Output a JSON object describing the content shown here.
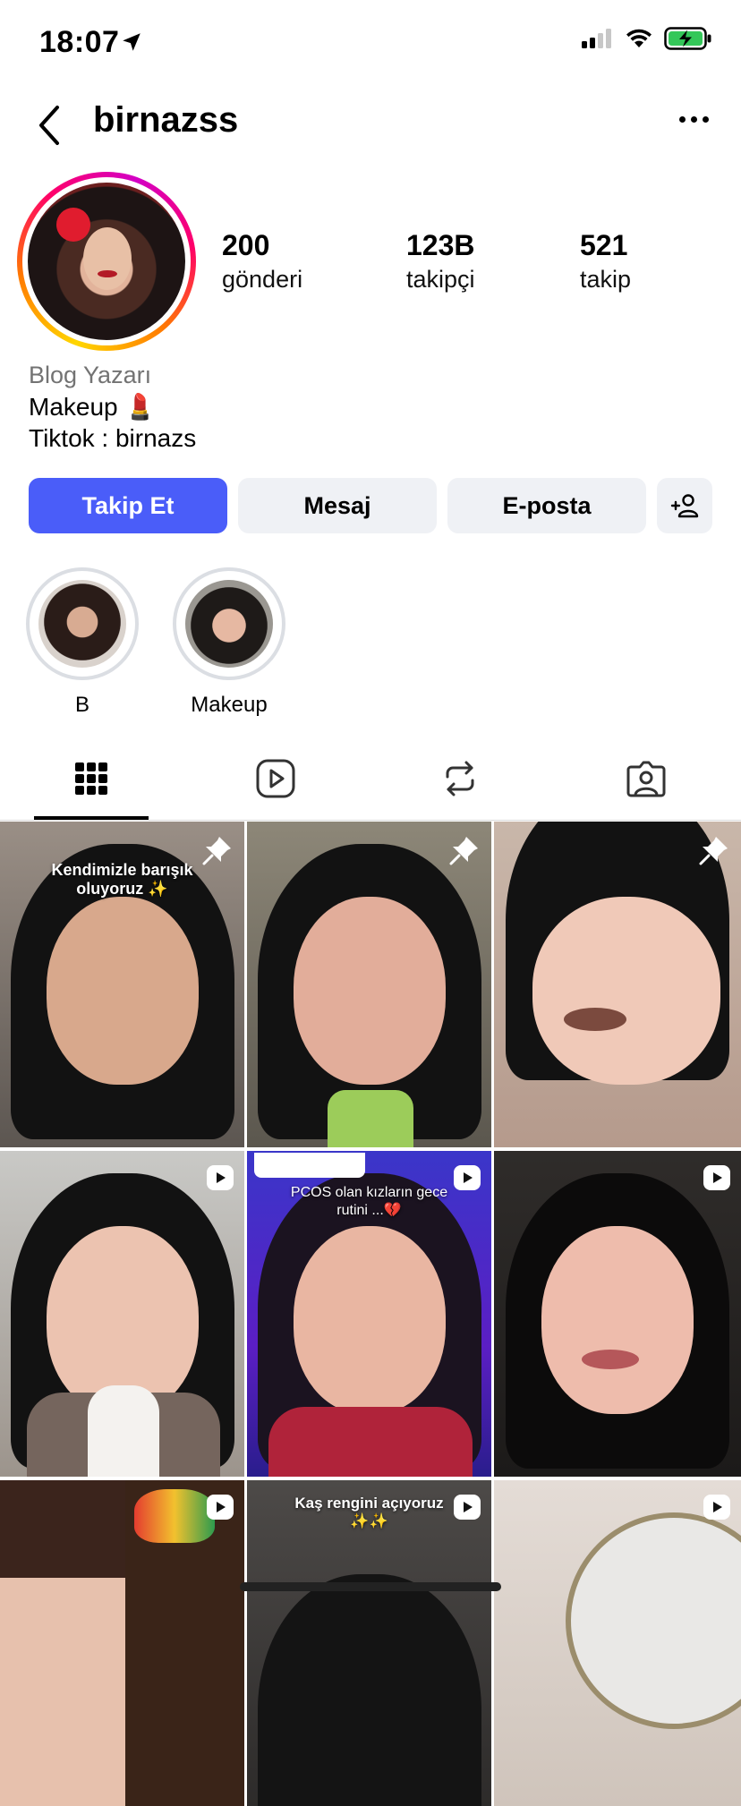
{
  "status_bar": {
    "time": "18:07"
  },
  "header": {
    "username": "birnazss"
  },
  "stats": [
    {
      "value": "200",
      "label": "gönderi"
    },
    {
      "value": "123B",
      "label": "takipçi"
    },
    {
      "value": "521",
      "label": "takip"
    }
  ],
  "bio": {
    "category": "Blog Yazarı",
    "line1": "Makeup 💄",
    "line2": "Tiktok : birnazs"
  },
  "actions": {
    "follow": "Takip Et",
    "message": "Mesaj",
    "email": "E-posta"
  },
  "highlights": [
    {
      "label": "B"
    },
    {
      "label": "Makeup"
    }
  ],
  "grid": {
    "posts": [
      {
        "caption": "Kendimizle barışık oluyoruz ✨",
        "badge": "pin"
      },
      {
        "caption": "",
        "badge": "pin"
      },
      {
        "caption": "",
        "badge": "pin"
      },
      {
        "caption": "",
        "badge": "reel"
      },
      {
        "caption": "PCOS olan kızların gece rutini ...💔",
        "badge": "reel"
      },
      {
        "caption": "",
        "badge": "reel"
      },
      {
        "caption": "",
        "badge": "reel"
      },
      {
        "caption": "Kaş rengini açıyoruz ✨✨",
        "badge": "reel"
      },
      {
        "caption": "",
        "badge": "reel"
      }
    ]
  },
  "colors": {
    "primary_button": "#4a5df9",
    "secondary_button": "#eff1f5",
    "muted_text": "#737373"
  }
}
